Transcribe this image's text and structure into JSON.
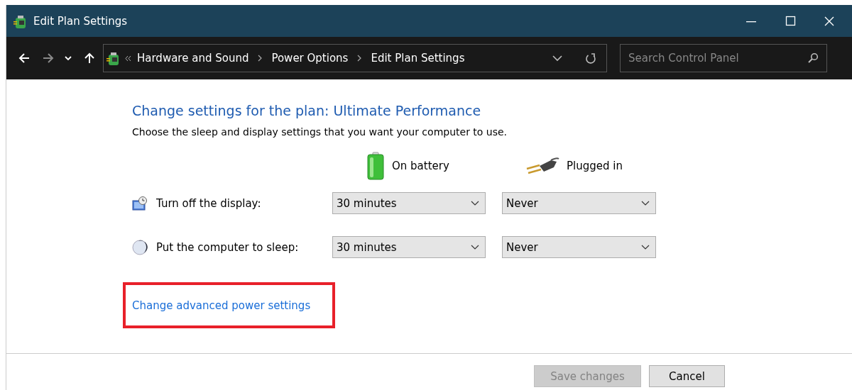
{
  "window": {
    "title": "Edit Plan Settings"
  },
  "nav": {
    "back_enabled": true,
    "forward_enabled": false,
    "breadcrumb": [
      "Hardware and Sound",
      "Power Options",
      "Edit Plan Settings"
    ],
    "search": {
      "placeholder": "Search Control Panel"
    }
  },
  "heading": "Change settings for the plan: Ultimate Performance",
  "description": "Choose the sleep and display settings that you want your computer to use.",
  "columns": [
    {
      "kind": "battery",
      "label": "On battery"
    },
    {
      "kind": "plug",
      "label": "Plugged in"
    }
  ],
  "settings": [
    {
      "kind": "display",
      "label": "Turn off the display:",
      "values": [
        "30 minutes",
        "Never"
      ]
    },
    {
      "kind": "sleep",
      "label": "Put the computer to sleep:",
      "values": [
        "30 minutes",
        "Never"
      ]
    }
  ],
  "advanced_link": {
    "label": "Change advanced power settings",
    "highlighted": true
  },
  "buttons": [
    {
      "label": "Save changes",
      "disabled": true
    },
    {
      "label": "Cancel",
      "disabled": false
    }
  ]
}
